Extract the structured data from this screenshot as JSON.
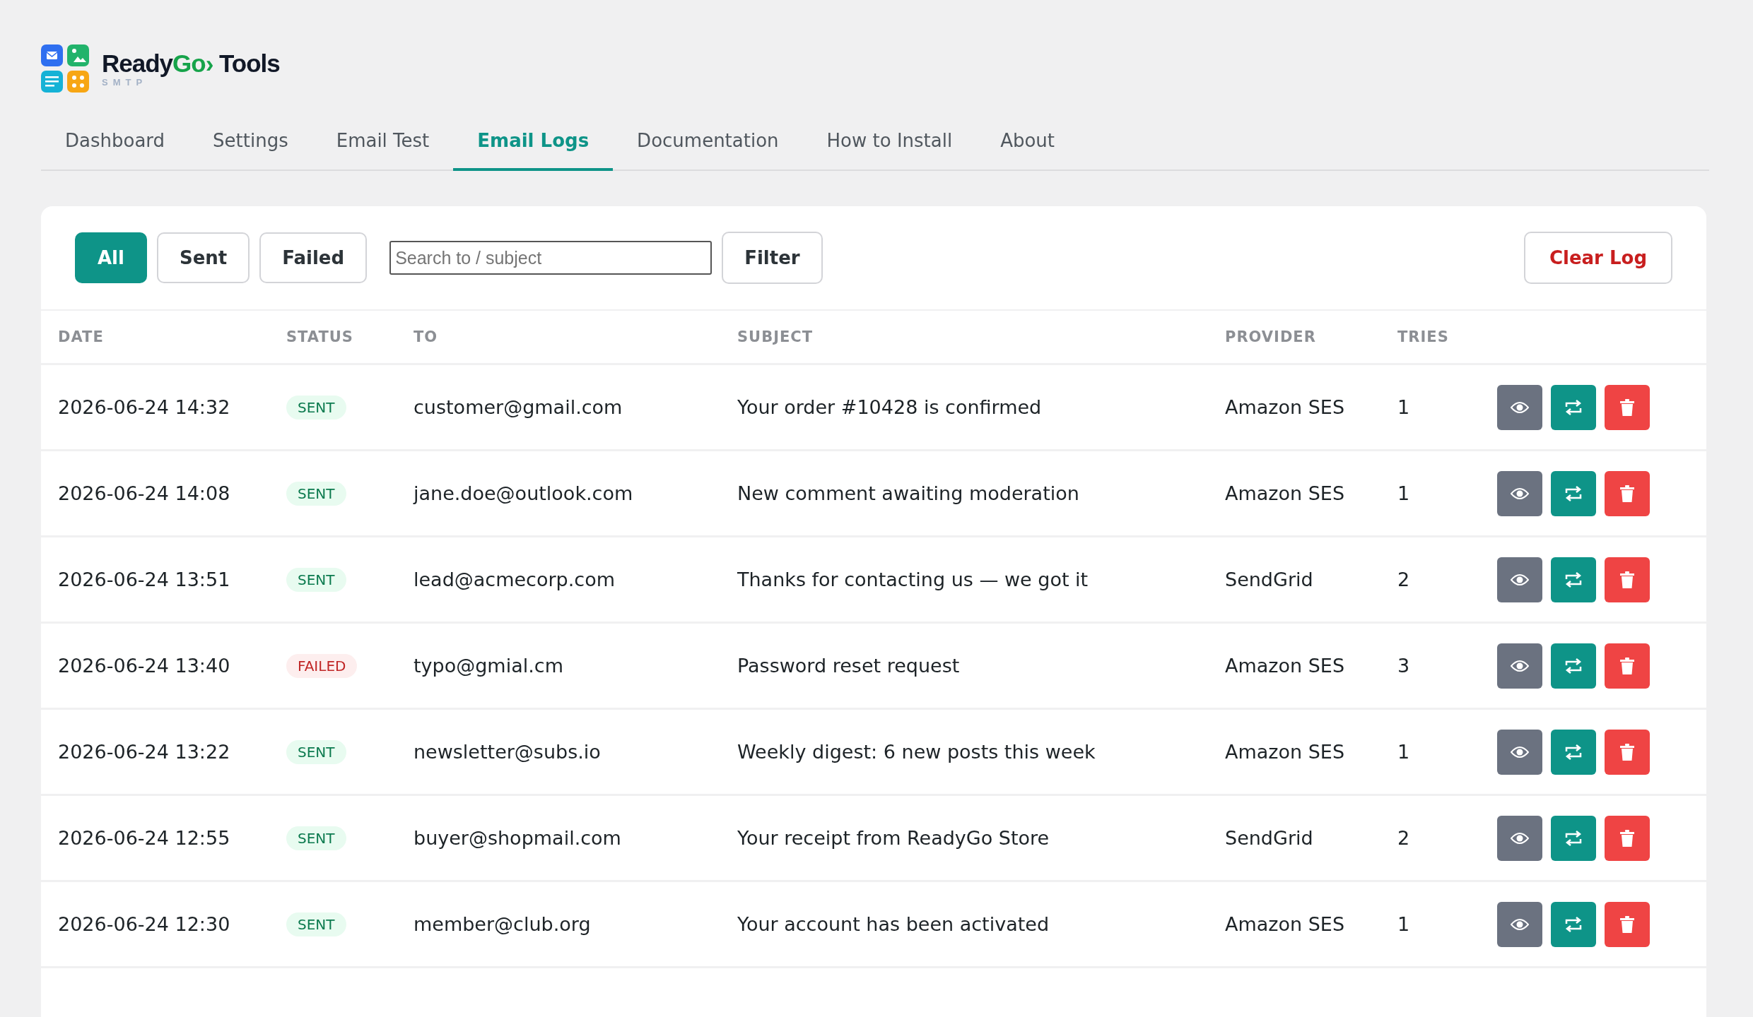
{
  "brand": {
    "name_start": "Ready",
    "name_accent": "Go›",
    "name_end": "Tools",
    "subtitle": "SMTP"
  },
  "tabs": [
    {
      "label": "Dashboard",
      "selected": false
    },
    {
      "label": "Settings",
      "selected": false
    },
    {
      "label": "Email Test",
      "selected": false
    },
    {
      "label": "Email Logs",
      "selected": true
    },
    {
      "label": "Documentation",
      "selected": false
    },
    {
      "label": "How to Install",
      "selected": false
    },
    {
      "label": "About",
      "selected": false
    }
  ],
  "filters": [
    {
      "label": "All",
      "selected": true
    },
    {
      "label": "Sent",
      "selected": false
    },
    {
      "label": "Failed",
      "selected": false
    }
  ],
  "search": {
    "placeholder": "Search to / subject"
  },
  "filter_button": "Filter",
  "clear_button": "Clear Log",
  "table": {
    "columns": [
      "DATE",
      "STATUS",
      "TO",
      "SUBJECT",
      "PROVIDER",
      "TRIES"
    ],
    "rows": [
      {
        "date": "2026-06-24 14:32",
        "status": "SENT",
        "kind": "sent",
        "to": "customer@gmail.com",
        "subject": "Your order #10428 is confirmed",
        "provider": "Amazon SES",
        "tries": "1"
      },
      {
        "date": "2026-06-24 14:08",
        "status": "SENT",
        "kind": "sent",
        "to": "jane.doe@outlook.com",
        "subject": "New comment awaiting moderation",
        "provider": "Amazon SES",
        "tries": "1"
      },
      {
        "date": "2026-06-24 13:51",
        "status": "SENT",
        "kind": "sent",
        "to": "lead@acmecorp.com",
        "subject": "Thanks for contacting us — we got it",
        "provider": "SendGrid",
        "tries": "2"
      },
      {
        "date": "2026-06-24 13:40",
        "status": "FAILED",
        "kind": "failed",
        "to": "typo@gmial.cm",
        "subject": "Password reset request",
        "provider": "Amazon SES",
        "tries": "3"
      },
      {
        "date": "2026-06-24 13:22",
        "status": "SENT",
        "kind": "sent",
        "to": "newsletter@subs.io",
        "subject": "Weekly digest: 6 new posts this week",
        "provider": "Amazon SES",
        "tries": "1"
      },
      {
        "date": "2026-06-24 12:55",
        "status": "SENT",
        "kind": "sent",
        "to": "buyer@shopmail.com",
        "subject": "Your receipt from ReadyGo Store",
        "provider": "SendGrid",
        "tries": "2"
      },
      {
        "date": "2026-06-24 12:30",
        "status": "SENT",
        "kind": "sent",
        "to": "member@club.org",
        "subject": "Your account has been activated",
        "provider": "Amazon SES",
        "tries": "1"
      }
    ]
  }
}
